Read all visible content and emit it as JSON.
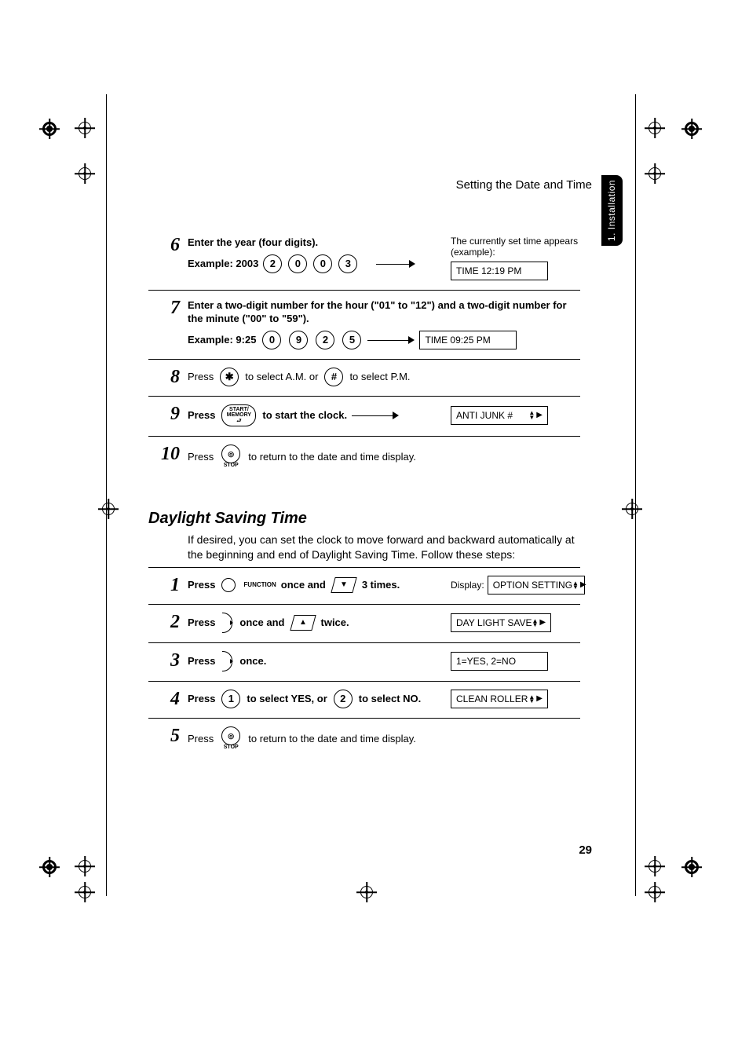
{
  "header": {
    "title": "Setting the Date and Time"
  },
  "tab": {
    "label": "1. Installation"
  },
  "steps_a": [
    {
      "num": "6",
      "instr": "Enter the year (four digits).",
      "example_label": "Example: 2003",
      "keys": [
        "2",
        "0",
        "0",
        "3"
      ],
      "side_note": "The currently set time appears (example):",
      "display": "TIME 12:19 PM"
    },
    {
      "num": "7",
      "instr": "Enter a two-digit number for the hour (\"01\" to \"12\") and a two-digit number for the minute (\"00\" to \"59\").",
      "example_label": "Example: 9:25",
      "keys": [
        "0",
        "9",
        "2",
        "5"
      ],
      "display": "TIME 09:25 PM"
    },
    {
      "num": "8",
      "press": "Press",
      "key1": "✱",
      "mid1": "to select A.M. or",
      "key2": "#",
      "mid2": "to select P.M."
    },
    {
      "num": "9",
      "press": "Press",
      "oval_top": "START/",
      "oval_mid": "MEMORY",
      "after": "to start the clock.",
      "display": "ANTI JUNK #"
    },
    {
      "num": "10",
      "press": "Press",
      "stop_icon": "◎",
      "stop_label": "STOP",
      "after": "to return to the date and time display."
    }
  ],
  "dst": {
    "heading": "Daylight Saving Time",
    "intro": "If desired, you can set the clock to move forward and backward automatically at the beginning and end of Daylight Saving Time. Follow these steps:"
  },
  "steps_b": [
    {
      "num": "1",
      "parts": [
        "Press",
        "FUNCTION",
        "once and",
        "3 times."
      ],
      "display_label": "Display:",
      "display": "OPTION SETTING"
    },
    {
      "num": "2",
      "parts": [
        "Press",
        "once and",
        "twice."
      ],
      "display": "DAY LIGHT SAVE"
    },
    {
      "num": "3",
      "parts": [
        "Press",
        "once."
      ],
      "display": "1=YES, 2=NO"
    },
    {
      "num": "4",
      "press": "Press",
      "key1": "1",
      "mid1": "to select YES, or",
      "key2": "2",
      "mid2": "to select NO.",
      "display": "CLEAN ROLLER"
    },
    {
      "num": "5",
      "press": "Press",
      "stop_icon": "◎",
      "stop_label": "STOP",
      "after": "to return to the date and time display."
    }
  ],
  "page_number": "29"
}
